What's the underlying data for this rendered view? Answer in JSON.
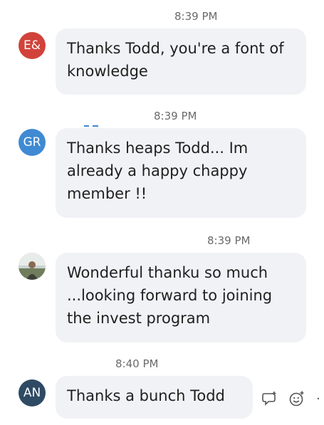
{
  "messages": [
    {
      "time": "8:39 PM",
      "avatar": {
        "initials": "E&",
        "color": "#d1433a"
      },
      "text": [
        "Thanks Todd, you're a font of",
        "knowledge"
      ]
    },
    {
      "time": "8:39 PM",
      "avatar": {
        "initials": "GR",
        "color": "#3f8ad3"
      },
      "text": [
        "Thanks heaps Todd... Im",
        "already a happy chappy",
        "member !!"
      ]
    },
    {
      "time": "8:39 PM",
      "avatar": {
        "initials": "",
        "color": "#7f8c7a"
      },
      "text": [
        "Wonderful thanku so much",
        "...looking forward to joining",
        "the invest program"
      ]
    },
    {
      "time": "8:40 PM",
      "avatar": {
        "initials": "AN",
        "color": "#2f4a64"
      },
      "text": [
        "Thanks a bunch Todd"
      ]
    }
  ],
  "actions": {
    "quote_icon": "quote-reply-icon",
    "reaction_icon": "add-reaction-icon",
    "more_label": "·"
  }
}
